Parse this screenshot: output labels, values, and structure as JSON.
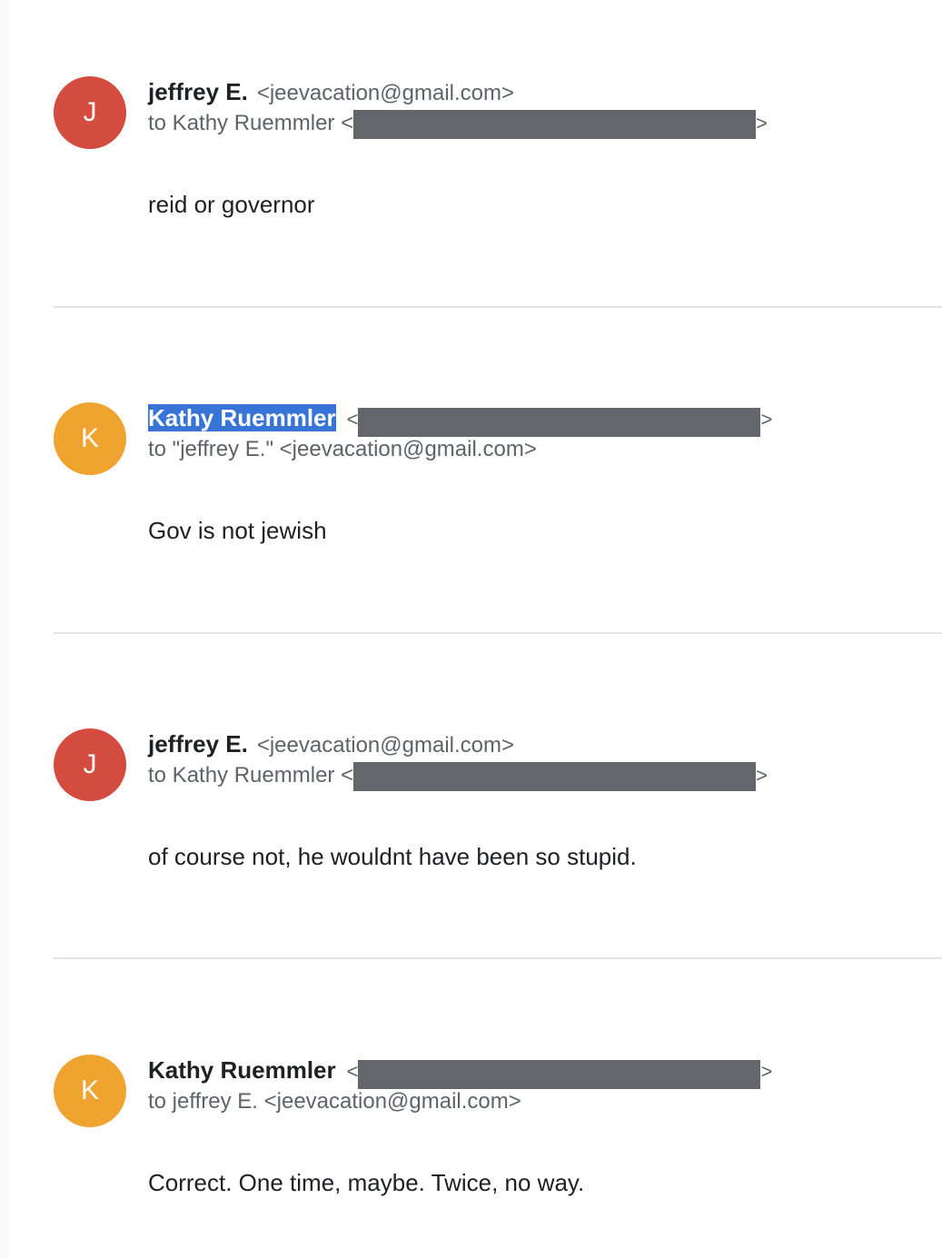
{
  "messages": [
    {
      "avatar_letter": "J",
      "avatar_color": "#d44c3f",
      "sender_name": "jeffrey E.",
      "sender_email": "<jeevacation@gmail.com>",
      "to_prefix": "to Kathy Ruemmler <",
      "to_suffix": ">",
      "body": "reid or governor"
    },
    {
      "avatar_letter": "K",
      "avatar_color": "#f0a430",
      "sender_name": "Kathy Ruemmler",
      "email_open": "<",
      "email_close": ">",
      "to_line": "to \"jeffrey E.\" <jeevacation@gmail.com>",
      "body": "Gov is not jewish"
    },
    {
      "avatar_letter": "J",
      "avatar_color": "#d44c3f",
      "sender_name": "jeffrey E.",
      "sender_email": "<jeevacation@gmail.com>",
      "to_prefix": "to Kathy Ruemmler <",
      "to_suffix": ">",
      "body": "of course not, he wouldnt have been so stupid."
    },
    {
      "avatar_letter": "K",
      "avatar_color": "#f0a430",
      "sender_name": "Kathy Ruemmler",
      "email_open": "<",
      "email_close": ">",
      "to_line": "to jeffrey E. <jeevacation@gmail.com>",
      "body": "Correct. One time, maybe. Twice, no way."
    }
  ],
  "colors": {
    "redaction": "#63666b",
    "selection_highlight": "#3874d8",
    "divider": "#e3e3e3"
  }
}
